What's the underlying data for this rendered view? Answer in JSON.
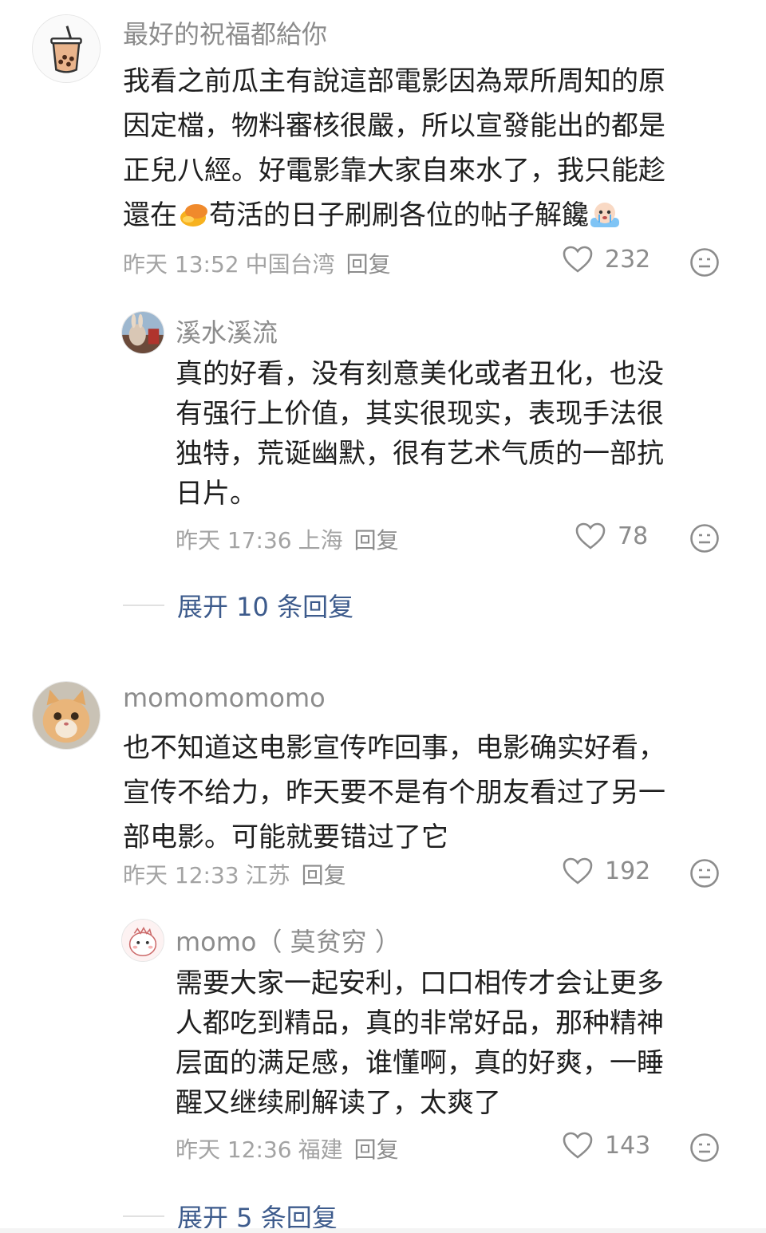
{
  "comments": [
    {
      "user": "最好的祝福都給你",
      "avatar_icon": "bubble-tea-icon",
      "lines": [
        "我看之前瓜主有說這部電影因為眾所周知的原",
        "因定檔，物料審核很嚴，所以宣發能出的都是",
        "正兒八經。好電影靠大家自來水了，我只能趁",
        "還在",
        "苟活的日子刷刷各位的帖子解饞"
      ],
      "inline_emojis": [
        "mango-emoji",
        "crying-face-emoji"
      ],
      "time": "昨天 13:52",
      "location": "中国台湾",
      "reply_label": "回复",
      "likes": "232"
    },
    {
      "user": "溪水溪流",
      "avatar_icon": "rabbit-photo-icon",
      "lines": [
        "真的好看，没有刻意美化或者丑化，也没",
        "有强行上价值，其实很现实，表现手法很",
        "独特，荒诞幽默，很有艺术气质的一部抗",
        "日片。"
      ],
      "time": "昨天 17:36",
      "location": "上海",
      "reply_label": "回复",
      "likes": "78"
    },
    {
      "user": "momomomomo",
      "avatar_icon": "cat-photo-icon",
      "lines": [
        "也不知道这电影宣传咋回事，电影确实好看，",
        "宣传不给力，昨天要不是有个朋友看过了另一",
        "部电影。可能就要错过了它"
      ],
      "time": "昨天 12:33",
      "location": "江苏",
      "reply_label": "回复",
      "likes": "192"
    },
    {
      "user": "momo（ 莫贫穷 ）",
      "avatar_icon": "cartoon-dino-icon",
      "lines": [
        "需要大家一起安利，口口相传才会让更多",
        "人都吃到精品，真的非常好品，那种精神",
        "层面的满足感，谁懂啊，真的好爽，一睡",
        "醒又继续刷解读了，太爽了"
      ],
      "time": "昨天 12:36",
      "location": "福建",
      "reply_label": "回复",
      "likes": "143"
    }
  ],
  "expand": [
    {
      "label": "展开 10 条回复"
    },
    {
      "label": "展开 5 条回复"
    }
  ],
  "colors": {
    "username": "#8c8c8c",
    "meta": "#a3a3a3",
    "link": "#3d5b8c",
    "text": "#1f1f1f"
  }
}
